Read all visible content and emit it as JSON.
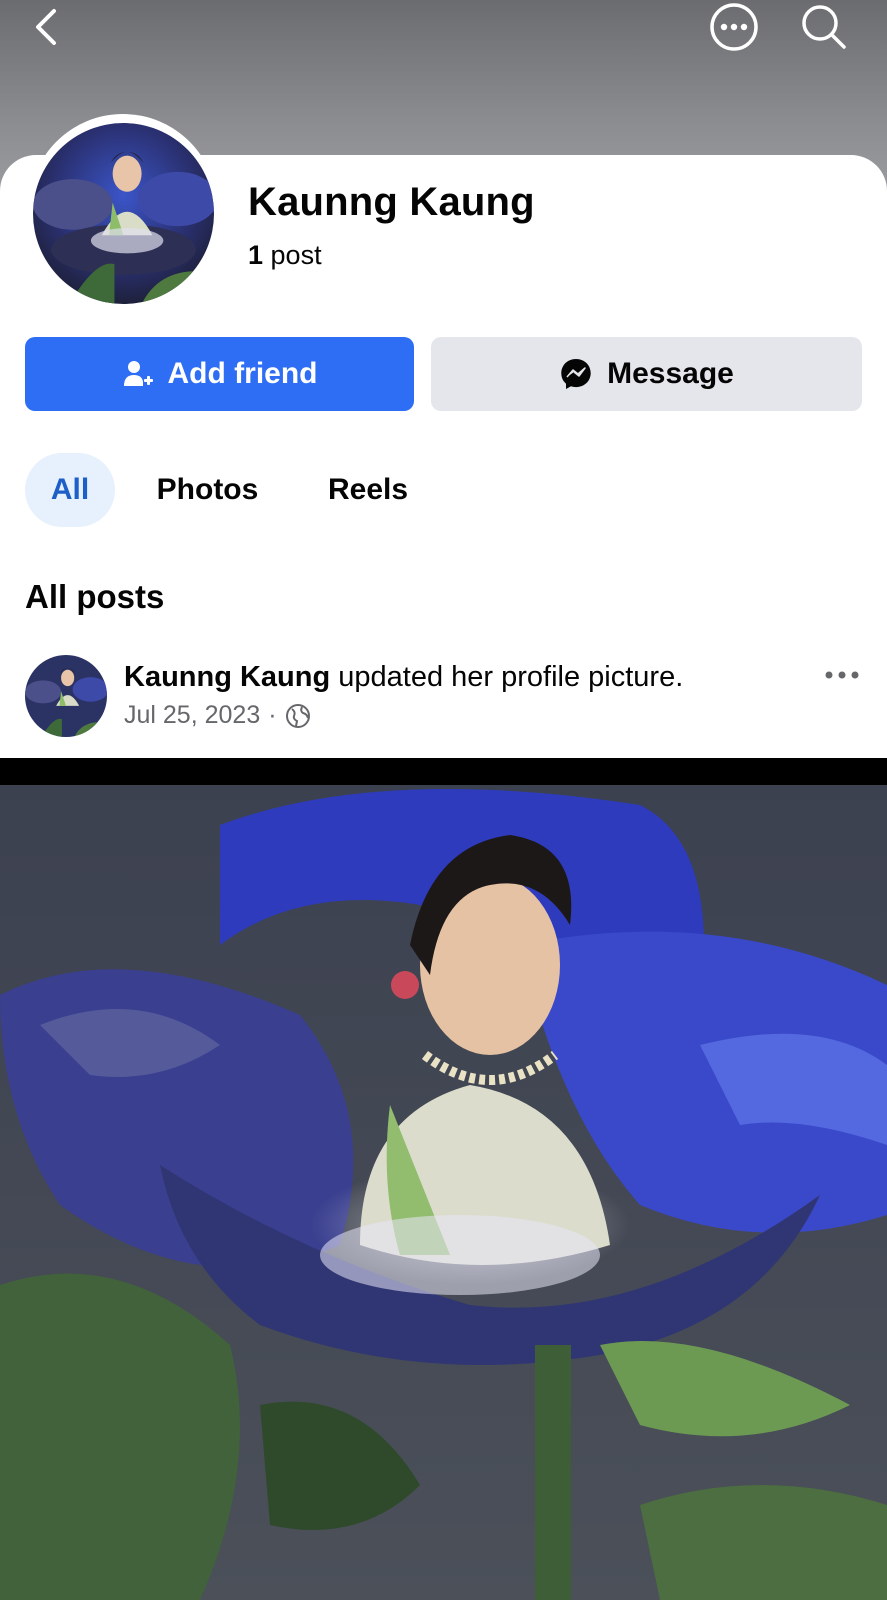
{
  "header": {
    "back_icon": "chevron-left-icon",
    "more_icon": "more-circle-icon",
    "search_icon": "search-icon"
  },
  "profile": {
    "name": "Kaunng Kaung",
    "post_count": "1",
    "post_label": " post"
  },
  "actions": {
    "add_friend_label": "Add friend",
    "add_friend_icon": "add-person-icon",
    "message_label": "Message",
    "message_icon": "messenger-icon",
    "primary_color": "#2e6ef4"
  },
  "tabs": [
    {
      "label": "All",
      "selected": true
    },
    {
      "label": "Photos",
      "selected": false
    },
    {
      "label": "Reels",
      "selected": false
    }
  ],
  "section": {
    "title": "All posts"
  },
  "post": {
    "author": "Kaunng Kaung",
    "action_text": " updated her profile picture.",
    "date": "Jul 25, 2023",
    "separator": "·",
    "privacy_icon": "globe-icon",
    "more_icon": "more-horizontal-icon"
  }
}
